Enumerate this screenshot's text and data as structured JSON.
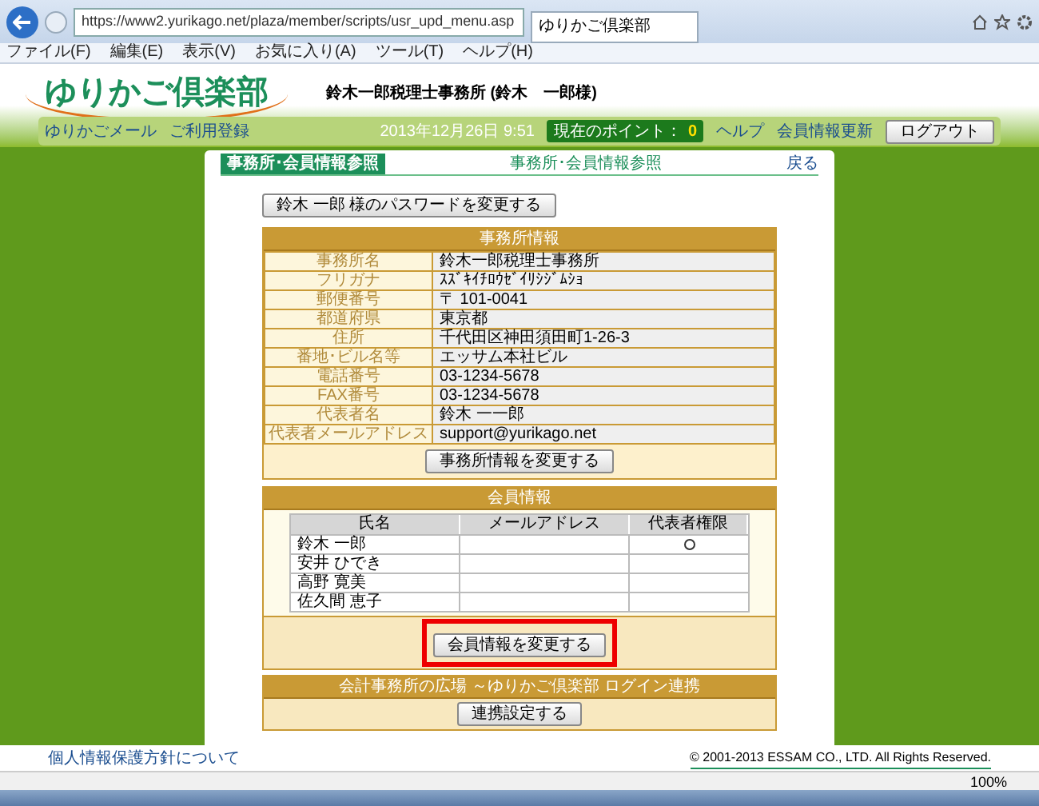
{
  "browser": {
    "url": "https://www2.yurikago.net/plaza/member/scripts/usr_upd_menu.asp",
    "tab_title": "ゆりかご倶楽部",
    "menu": [
      "ファイル(F)",
      "編集(E)",
      "表示(V)",
      "お気に入り(A)",
      "ツール(T)",
      "ヘルプ(H)"
    ],
    "zoom": "100%"
  },
  "header": {
    "logo": "ゆりかご倶楽部",
    "office_name": "鈴木一郎税理士事務所 (鈴木　一郎様)",
    "nav_links": [
      "ゆりかごメール",
      "ご利用登録"
    ],
    "datetime": "2013年12月26日 9:51",
    "points_label": "現在のポイント：",
    "points": "0",
    "help": "ヘルプ",
    "update": "会員情報更新",
    "logout": "ログアウト"
  },
  "page": {
    "title": "事務所･会員情報参照",
    "breadcrumb": "事務所･会員情報参照",
    "back": "戻る",
    "password_button": "鈴木 一郎 様のパスワードを変更する"
  },
  "office": {
    "heading": "事務所情報",
    "fields": [
      {
        "label": "事務所名",
        "value": "鈴木一郎税理士事務所"
      },
      {
        "label": "フリガナ",
        "value": "ｽｽﾞｷｲﾁﾛｳｾﾞｲﾘｼｼﾞﾑｼｮ"
      },
      {
        "label": "郵便番号",
        "value": "〒 101-0041"
      },
      {
        "label": "都道府県",
        "value": "東京都"
      },
      {
        "label": "住所",
        "value": "千代田区神田須田町1-26-3"
      },
      {
        "label": "番地･ビル名等",
        "value": "エッサム本社ビル"
      },
      {
        "label": "電話番号",
        "value": "03-1234-5678"
      },
      {
        "label": "FAX番号",
        "value": "03-1234-5678"
      },
      {
        "label": "代表者名",
        "value": "鈴木 一一郎"
      },
      {
        "label": "代表者メールアドレス",
        "value": "support@yurikago.net"
      }
    ],
    "button": "事務所情報を変更する"
  },
  "members": {
    "heading": "会員情報",
    "columns": [
      "氏名",
      "メールアドレス",
      "代表者権限"
    ],
    "rows": [
      {
        "name": "鈴木 一郎",
        "representative": true
      },
      {
        "name": "安井 ひでき",
        "representative": false
      },
      {
        "name": "高野 寛美",
        "representative": false
      },
      {
        "name": "佐久間 恵子",
        "representative": false
      }
    ],
    "button": "会員情報を変更する",
    "button_highlighted": true
  },
  "link_section": {
    "heading": "会計事務所の広場 ～ゆりかご倶楽部 ログイン連携",
    "button": "連携設定する"
  },
  "footer": {
    "privacy_link": "個人情報保護方針について",
    "copyright": "© 2001-2013 ESSAM CO., LTD. All Rights Reserved."
  }
}
